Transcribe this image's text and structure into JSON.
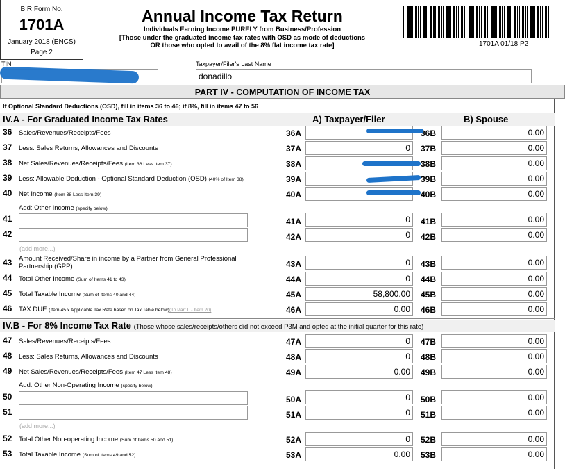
{
  "header": {
    "form_label": "BIR Form No.",
    "form_number": "1701A",
    "version": "January 2018 (ENCS)",
    "page": "Page 2",
    "title": "Annual Income Tax Return",
    "subtitle_1": "Individuals Earning Income PURELY from Business/Profession",
    "subtitle_2": "[Those under the graduated income tax rates with OSD as mode of deductions",
    "subtitle_3": "OR those who opted to avail of the 8% flat income tax rate]",
    "barcode_label": "1701A 01/18 P2"
  },
  "taxpayer": {
    "tin_label": "TIN",
    "name_label": "Taxpayer/Filer's Last Name",
    "last_name": "donadillo"
  },
  "part_title": "PART IV - COMPUTATION OF INCOME TAX",
  "note": "If Optional Standard Deductions (OSD), fill in items 36 to 46; if 8%, fill in items 47 to 56",
  "section_a": {
    "title": "IV.A - For Graduated Income Tax Rates",
    "col_a": "A) Taxpayer/Filer",
    "col_b": "B) Spouse",
    "rows": [
      {
        "no": "36",
        "label": "Sales/Revenues/Receipts/Fees",
        "hint": "",
        "ca": "36A",
        "va": "",
        "cb": "36B",
        "vb": "0.00"
      },
      {
        "no": "37",
        "label": "Less: Sales Returns, Allowances and Discounts",
        "hint": "",
        "ca": "37A",
        "va": "0",
        "cb": "37B",
        "vb": "0.00"
      },
      {
        "no": "38",
        "label": "Net Sales/Revenues/Receipts/Fees",
        "hint": "(Item 36 Less Item 37)",
        "ca": "38A",
        "va": "",
        "cb": "38B",
        "vb": "0.00"
      },
      {
        "no": "39",
        "label": "Less: Allowable Deduction - Optional Standard Deduction (OSD)",
        "hint": "(40% of Item 38)",
        "ca": "39A",
        "va": "",
        "cb": "39B",
        "vb": "0.00"
      },
      {
        "no": "40",
        "label": "Net Income",
        "hint": "(Item 38 Less Item 39)",
        "ca": "40A",
        "va": "",
        "cb": "40B",
        "vb": "0.00"
      }
    ],
    "add_other": "Add: Other Income",
    "add_other_hint": "(specify below)",
    "other_rows": [
      {
        "no": "41",
        "ca": "41A",
        "va": "0",
        "cb": "41B",
        "vb": "0.00"
      },
      {
        "no": "42",
        "ca": "42A",
        "va": "0",
        "cb": "42B",
        "vb": "0.00"
      }
    ],
    "add_more": "(add more...)",
    "row43": {
      "no": "43",
      "label": "Amount Received/Share in income by a Partner from General Professional Partnership (GPP)",
      "ca": "43A",
      "va": "0",
      "cb": "43B",
      "vb": "0.00"
    },
    "row44": {
      "no": "44",
      "label": "Total Other Income",
      "hint": "(Sum of Items 41 to 43)",
      "ca": "44A",
      "va": "0",
      "cb": "44B",
      "vb": "0.00"
    },
    "row45": {
      "no": "45",
      "label": "Total Taxable Income",
      "hint": "(Sum of Items 40 and 44)",
      "ca": "45A",
      "va": "58,800.00",
      "cb": "45B",
      "vb": "0.00"
    },
    "row46": {
      "no": "46",
      "label": "TAX DUE",
      "hint": "(Item 45 x Applicable Tax Rate based on Tax Table below)",
      "link": "(To Part II - Item 20)",
      "ca": "46A",
      "va": "0.00",
      "cb": "46B",
      "vb": "0.00"
    }
  },
  "section_b": {
    "title": "IV.B - For 8% Income Tax Rate",
    "note": "(Those whose sales/receipts/others did not exceed P3M and opted at the initial quarter for this rate)",
    "rows": [
      {
        "no": "47",
        "label": "Sales/Revenues/Receipts/Fees",
        "hint": "",
        "ca": "47A",
        "va": "0",
        "cb": "47B",
        "vb": "0.00"
      },
      {
        "no": "48",
        "label": "Less: Sales Returns, Allowances and Discounts",
        "hint": "",
        "ca": "48A",
        "va": "0",
        "cb": "48B",
        "vb": "0.00"
      },
      {
        "no": "49",
        "label": "Net Sales/Revenues/Receipts/Fees",
        "hint": "(Item 47 Less Item 48)",
        "ca": "49A",
        "va": "0.00",
        "cb": "49B",
        "vb": "0.00"
      }
    ],
    "add_other": "Add: Other Non-Operating Income",
    "add_other_hint": "(specify below)",
    "other_rows": [
      {
        "no": "50",
        "ca": "50A",
        "va": "0",
        "cb": "50B",
        "vb": "0.00"
      },
      {
        "no": "51",
        "ca": "51A",
        "va": "0",
        "cb": "51B",
        "vb": "0.00"
      }
    ],
    "add_more": "(add more...)",
    "row52": {
      "no": "52",
      "label": "Total Other Non-operating Income",
      "hint": "(Sum of Items 50 and 51)",
      "ca": "52A",
      "va": "0",
      "cb": "52B",
      "vb": "0.00"
    },
    "row53": {
      "no": "53",
      "label": "Total Taxable Income",
      "hint": "(Sum of Items 49 and 52)",
      "ca": "53A",
      "va": "0.00",
      "cb": "53B",
      "vb": "0.00"
    }
  },
  "colors": {
    "redaction": "#1e73c9",
    "section_bg": "#f0f0f0",
    "part_bg": "#e6e6e6"
  }
}
